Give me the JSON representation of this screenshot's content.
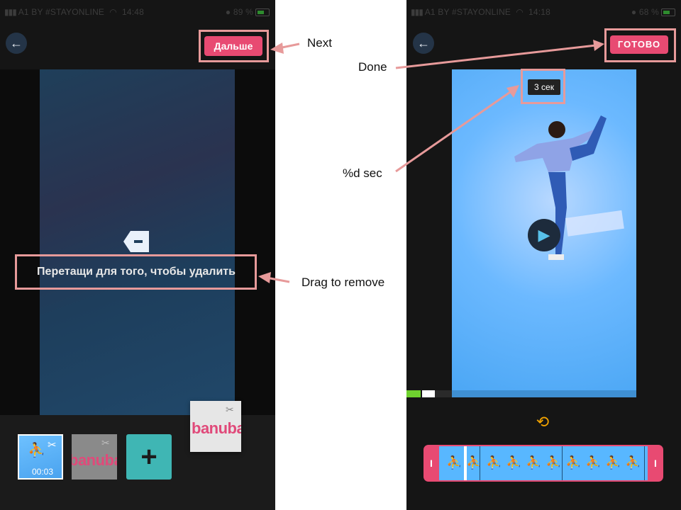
{
  "left_screen": {
    "status": {
      "carrier": "A1 BY #STAYONLINE",
      "time": "14:48",
      "battery": "89 %"
    },
    "back_icon": "←",
    "next_button": "Дальше",
    "drag_hint": "Перетащи для того, чтобы удалить",
    "add_icon": "+",
    "thumb_duration": "00:03",
    "banuba_label": "banuba"
  },
  "right_screen": {
    "status": {
      "carrier": "A1 BY #STAYONLINE",
      "time": "14:18",
      "battery": "68 %"
    },
    "back_icon": "←",
    "done_button": "ГОТОВО",
    "duration_badge": "3 сек",
    "play_icon": "▶",
    "rotate_icon": "⟲",
    "handle_glyph": "I"
  },
  "annotations": {
    "next": "Next",
    "done": "Done",
    "sec": "%d sec",
    "drag": "Drag to remove"
  },
  "colors": {
    "accent_pink": "#e84a72",
    "annotation": "#e79a9a",
    "teal_add": "#3fb6b4",
    "progress_green": "#6fd22f"
  }
}
